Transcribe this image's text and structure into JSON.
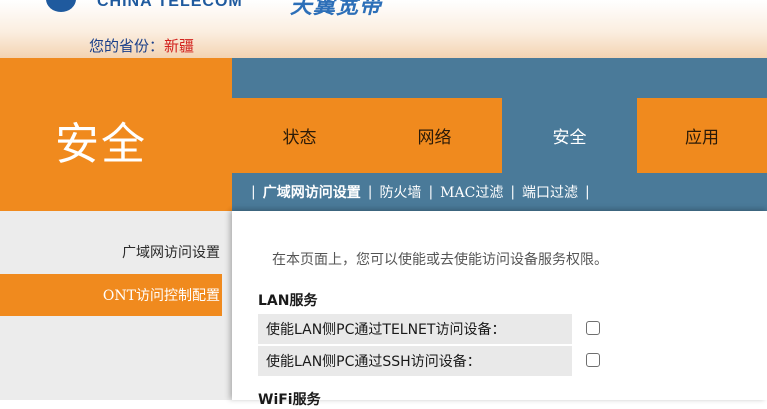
{
  "header": {
    "brand_en": "CHINA TELECOM",
    "brand_cn": "天翼宽带",
    "province_label": "您的省份：",
    "province_value": "新疆"
  },
  "section": {
    "title": "安全"
  },
  "nav": {
    "tabs": [
      {
        "label": "状态",
        "active": false
      },
      {
        "label": "网络",
        "active": false
      },
      {
        "label": "安全",
        "active": true
      },
      {
        "label": "应用",
        "active": false
      }
    ],
    "subnav": {
      "separator": "|",
      "items": [
        "广域网访问设置",
        "防火墙",
        "MAC过滤",
        "端口过滤"
      ]
    }
  },
  "side_menu": {
    "items": [
      {
        "label": "广域网访问设置",
        "active": false
      },
      {
        "label": "ONT访问控制配置",
        "active": true
      }
    ]
  },
  "main": {
    "intro": "在本页面上，您可以使能或去使能访问设备服务权限。",
    "lan_group": {
      "label": "LAN服务",
      "options": [
        {
          "label": "使能LAN侧PC通过TELNET访问设备：",
          "checked": false
        },
        {
          "label": "使能LAN侧PC通过SSH访问设备：",
          "checked": false
        }
      ]
    },
    "wifi_group": {
      "label": "WiFi服务"
    }
  },
  "colors": {
    "orange": "#f08a1e",
    "steel_blue": "#4a7a99",
    "brand_blue": "#1f5a9e",
    "province_red": "#d2201c"
  }
}
